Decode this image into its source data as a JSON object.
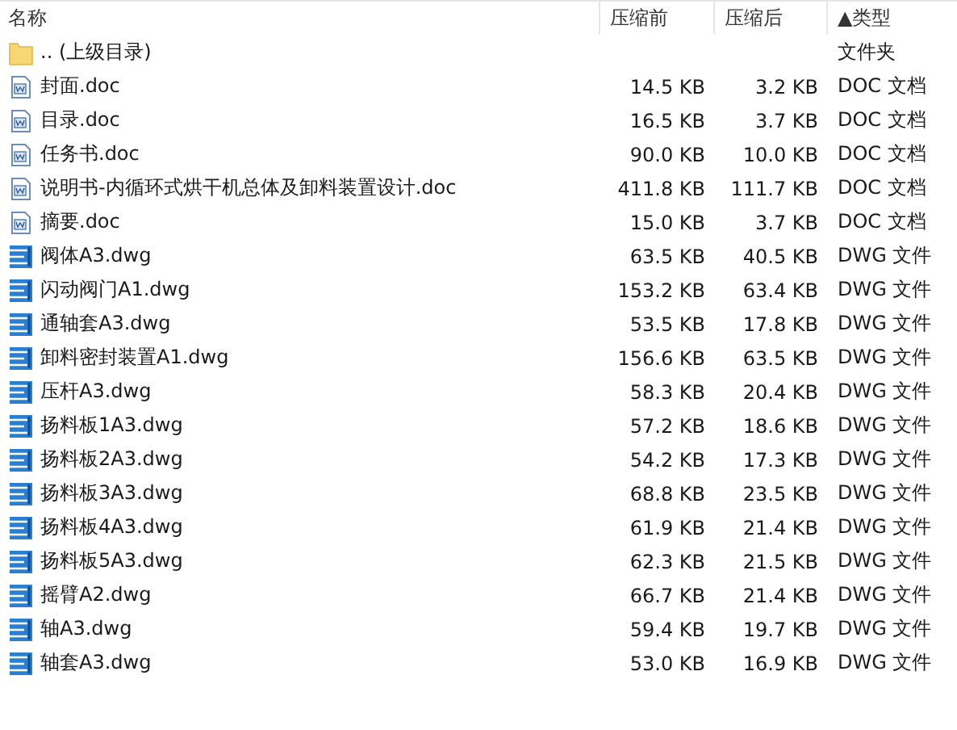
{
  "columns": [
    {
      "label": "名称"
    },
    {
      "label": "压缩前"
    },
    {
      "label": "压缩后"
    },
    {
      "label": "类型",
      "sort_mark": "▲"
    }
  ],
  "rows": [
    {
      "kind": "folder",
      "name": ".. (上级目录)",
      "size": "",
      "packed": "",
      "type": "文件夹"
    },
    {
      "kind": "doc",
      "name": "封面.doc",
      "size": "14.5 KB",
      "packed": "3.2 KB",
      "type": "DOC 文档"
    },
    {
      "kind": "doc",
      "name": "目录.doc",
      "size": "16.5 KB",
      "packed": "3.7 KB",
      "type": "DOC 文档"
    },
    {
      "kind": "doc",
      "name": "任务书.doc",
      "size": "90.0 KB",
      "packed": "10.0 KB",
      "type": "DOC 文档"
    },
    {
      "kind": "doc",
      "name": "说明书-内循环式烘干机总体及卸料装置设计.doc",
      "size": "411.8 KB",
      "packed": "111.7 KB",
      "type": "DOC 文档"
    },
    {
      "kind": "doc",
      "name": "摘要.doc",
      "size": "15.0 KB",
      "packed": "3.7 KB",
      "type": "DOC 文档"
    },
    {
      "kind": "dwg",
      "name": "阀体A3.dwg",
      "size": "63.5 KB",
      "packed": "40.5 KB",
      "type": "DWG 文件"
    },
    {
      "kind": "dwg",
      "name": "闪动阀门A1.dwg",
      "size": "153.2 KB",
      "packed": "63.4 KB",
      "type": "DWG 文件"
    },
    {
      "kind": "dwg",
      "name": "通轴套A3.dwg",
      "size": "53.5 KB",
      "packed": "17.8 KB",
      "type": "DWG 文件"
    },
    {
      "kind": "dwg",
      "name": "卸料密封装置A1.dwg",
      "size": "156.6 KB",
      "packed": "63.5 KB",
      "type": "DWG 文件"
    },
    {
      "kind": "dwg",
      "name": "压杆A3.dwg",
      "size": "58.3 KB",
      "packed": "20.4 KB",
      "type": "DWG 文件"
    },
    {
      "kind": "dwg",
      "name": "扬料板1A3.dwg",
      "size": "57.2 KB",
      "packed": "18.6 KB",
      "type": "DWG 文件"
    },
    {
      "kind": "dwg",
      "name": "扬料板2A3.dwg",
      "size": "54.2 KB",
      "packed": "17.3 KB",
      "type": "DWG 文件"
    },
    {
      "kind": "dwg",
      "name": "扬料板3A3.dwg",
      "size": "68.8 KB",
      "packed": "23.5 KB",
      "type": "DWG 文件"
    },
    {
      "kind": "dwg",
      "name": "扬料板4A3.dwg",
      "size": "61.9 KB",
      "packed": "21.4 KB",
      "type": "DWG 文件"
    },
    {
      "kind": "dwg",
      "name": "扬料板5A3.dwg",
      "size": "62.3 KB",
      "packed": "21.5 KB",
      "type": "DWG 文件"
    },
    {
      "kind": "dwg",
      "name": "摇臂A2.dwg",
      "size": "66.7 KB",
      "packed": "21.4 KB",
      "type": "DWG 文件"
    },
    {
      "kind": "dwg",
      "name": "轴A3.dwg",
      "size": "59.4 KB",
      "packed": "19.7 KB",
      "type": "DWG 文件"
    },
    {
      "kind": "dwg",
      "name": "轴套A3.dwg",
      "size": "53.0 KB",
      "packed": "16.9 KB",
      "type": "DWG 文件"
    }
  ]
}
